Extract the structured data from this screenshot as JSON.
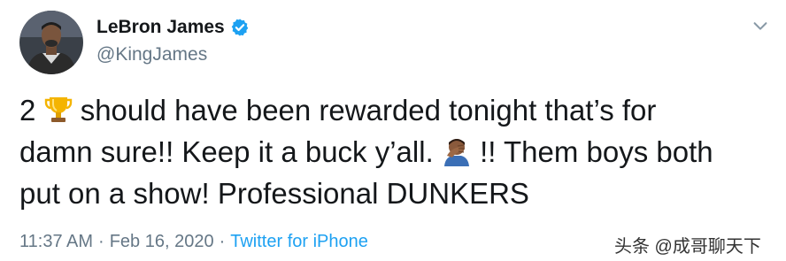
{
  "author": {
    "display_name": "LeBron James",
    "handle": "@KingJames",
    "verified": true,
    "verified_color": "#1da1f2"
  },
  "tweet": {
    "line1_a": "2",
    "line1_emoji": "trophy-icon",
    "line1_b": "should have been rewarded tonight that’s for",
    "line2_a": "damn sure!! Keep it a buck y’all.",
    "line2_emoji": "facepalm-icon",
    "line2_b": "!! Them boys both",
    "line3": "put on a show! Professional DUNKERS"
  },
  "meta": {
    "time": "11:37 AM",
    "separator": "·",
    "date": "Feb 16, 2020",
    "source": "Twitter for iPhone",
    "source_color": "#1da1f2"
  },
  "watermark": {
    "text": "头条 @成哥聊天下"
  }
}
